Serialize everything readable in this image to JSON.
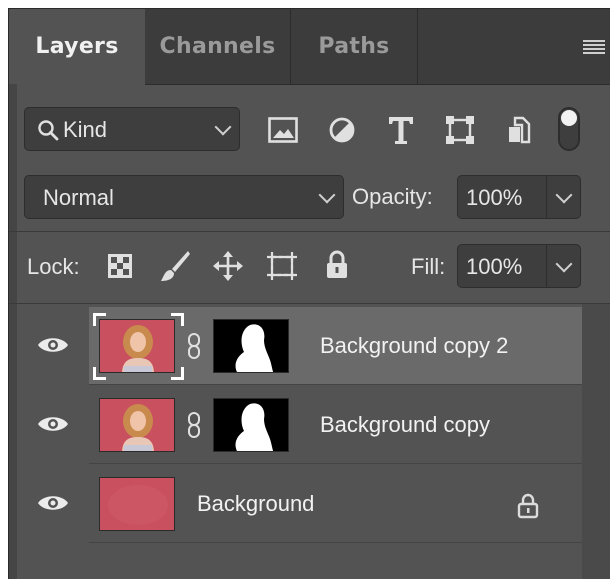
{
  "tabs": [
    {
      "label": "Layers",
      "active": true
    },
    {
      "label": "Channels",
      "active": false
    },
    {
      "label": "Paths",
      "active": false
    }
  ],
  "filter": {
    "label": "Kind",
    "icons": [
      "image-filter-icon",
      "adjustment-filter-icon",
      "type-filter-icon",
      "shape-filter-icon",
      "smart-object-filter-icon",
      "filter-toggle-icon"
    ]
  },
  "blend": {
    "mode": "Normal",
    "opacity_label": "Opacity:",
    "opacity_value": "100%"
  },
  "lock": {
    "label": "Lock:",
    "icons": [
      "lock-transparent-pixels-icon",
      "lock-image-pixels-icon",
      "lock-position-icon",
      "lock-artboard-icon",
      "lock-all-icon"
    ],
    "fill_label": "Fill:",
    "fill_value": "100%"
  },
  "layers": [
    {
      "name": "Background copy 2",
      "selected": true,
      "has_mask": true,
      "locked": false,
      "visible": true
    },
    {
      "name": "Background copy",
      "selected": false,
      "has_mask": true,
      "locked": false,
      "visible": true
    },
    {
      "name": "Background",
      "selected": false,
      "has_mask": false,
      "locked": true,
      "visible": true
    }
  ],
  "colors": {
    "panel": "#535353",
    "selected_row": "#6a6a6a",
    "thumb_bg": "#c9505f"
  }
}
